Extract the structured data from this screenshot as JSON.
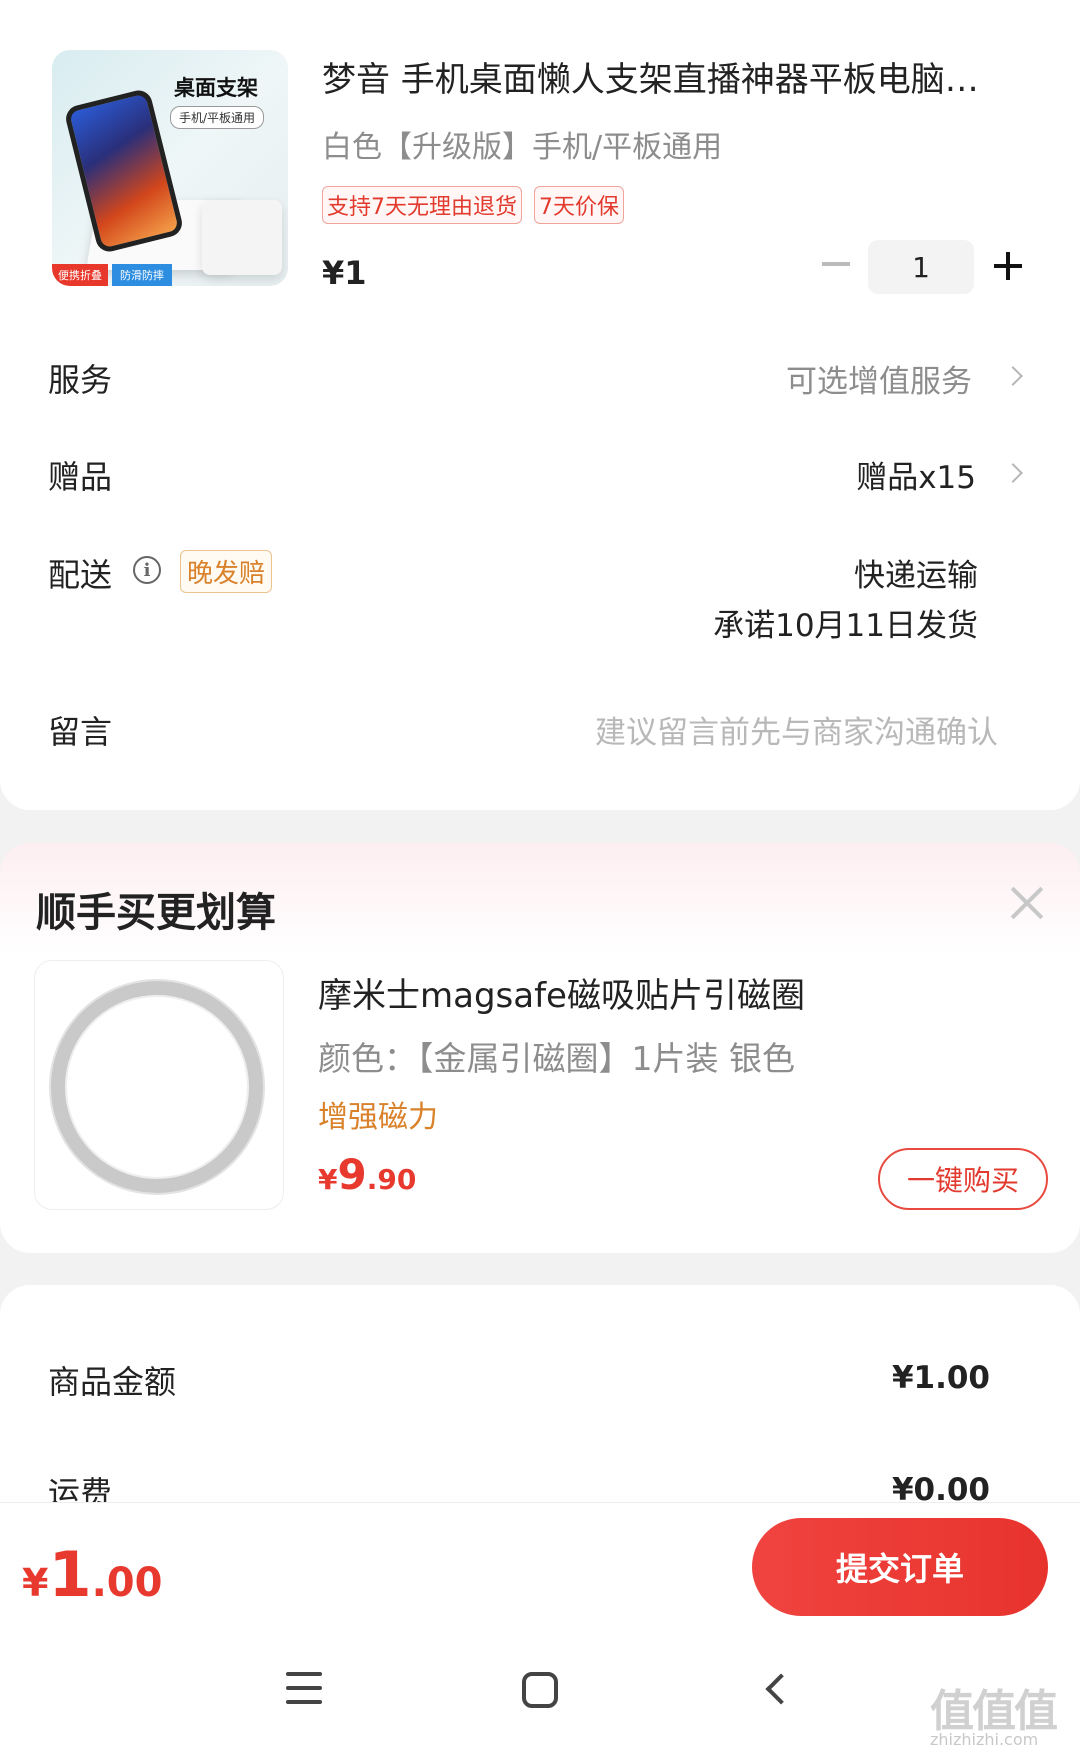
{
  "product": {
    "title": "梦音 手机桌面懒人支架直播神器平板电脑…",
    "spec": "白色【升级版】手机/平板通用",
    "tags": [
      "支持7天无理由退货",
      "7天价保"
    ],
    "price": "¥1",
    "quantity": "1",
    "image_text": {
      "title": "桌面支架",
      "subtitle": "手机/平板通用",
      "badge1": "便携折叠",
      "badge2": "防滑防摔"
    }
  },
  "rows": {
    "service": {
      "label": "服务",
      "value": "可选增值服务"
    },
    "gift": {
      "label": "赠品",
      "value": "赠品x15"
    },
    "delivery": {
      "label": "配送",
      "badge": "晚发赔",
      "method": "快递运输",
      "promise": "承诺10月11日发货"
    },
    "message": {
      "label": "留言",
      "placeholder": "建议留言前先与商家沟通确认"
    }
  },
  "recommend": {
    "heading": "顺手买更划算",
    "title": "摩米士magsafe磁吸贴片引磁圈",
    "spec": "颜色：【金属引磁圈】1片装 银色",
    "feature": "增强磁力",
    "price_symbol": "¥",
    "price_int": "9",
    "price_dec": ".90",
    "buy_label": "一键购买"
  },
  "summary": {
    "goods_label": "商品金额",
    "goods_value": "¥1.00",
    "shipping_label": "运费",
    "shipping_value": "¥0.00"
  },
  "footer": {
    "total_symbol": "¥",
    "total_int": "1",
    "total_dec": ".00",
    "submit_label": "提交订单"
  },
  "watermark": {
    "main": "值值值",
    "sub": "zhizhizhi.com"
  },
  "colors": {
    "accent": "#e8392f",
    "orange": "#d9822b",
    "gray_text": "#8d8d8d"
  }
}
